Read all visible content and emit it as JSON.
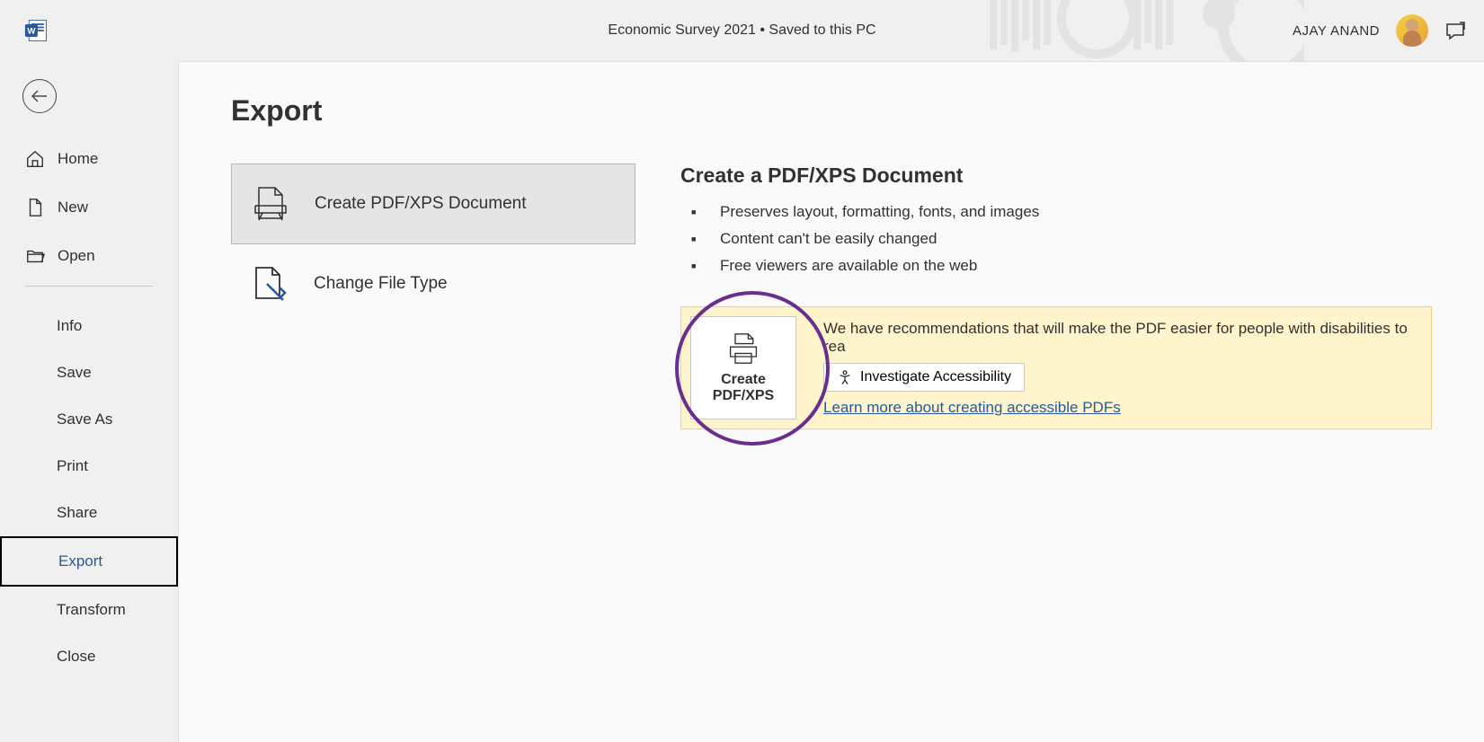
{
  "title_bar": {
    "document_title": "Economic Survey 2021 • Saved to this PC",
    "user_name": "AJAY ANAND"
  },
  "sidebar": {
    "items": [
      {
        "label": "Home",
        "icon": "home"
      },
      {
        "label": "New",
        "icon": "document"
      },
      {
        "label": "Open",
        "icon": "folder"
      },
      {
        "label": "Info",
        "sub": true
      },
      {
        "label": "Save",
        "sub": true
      },
      {
        "label": "Save As",
        "sub": true
      },
      {
        "label": "Print",
        "sub": true
      },
      {
        "label": "Share",
        "sub": true
      },
      {
        "label": "Export",
        "sub": true,
        "active": true
      },
      {
        "label": "Transform",
        "sub": true
      },
      {
        "label": "Close",
        "sub": true
      }
    ]
  },
  "content": {
    "page_title": "Export",
    "export_options": [
      {
        "label": "Create PDF/XPS Document",
        "selected": true
      },
      {
        "label": "Change File Type",
        "selected": false
      }
    ],
    "detail": {
      "title": "Create a PDF/XPS Document",
      "bullets": [
        "Preserves layout, formatting, fonts, and images",
        "Content can't be easily changed",
        "Free viewers are available on the web"
      ]
    },
    "accessibility": {
      "message": "We have recommendations that will make the PDF easier for people with disabilities to rea",
      "button_label": "Investigate Accessibility",
      "link_text": "Learn more about creating accessible PDFs",
      "create_btn_line1": "Create",
      "create_btn_line2": "PDF/XPS"
    }
  }
}
